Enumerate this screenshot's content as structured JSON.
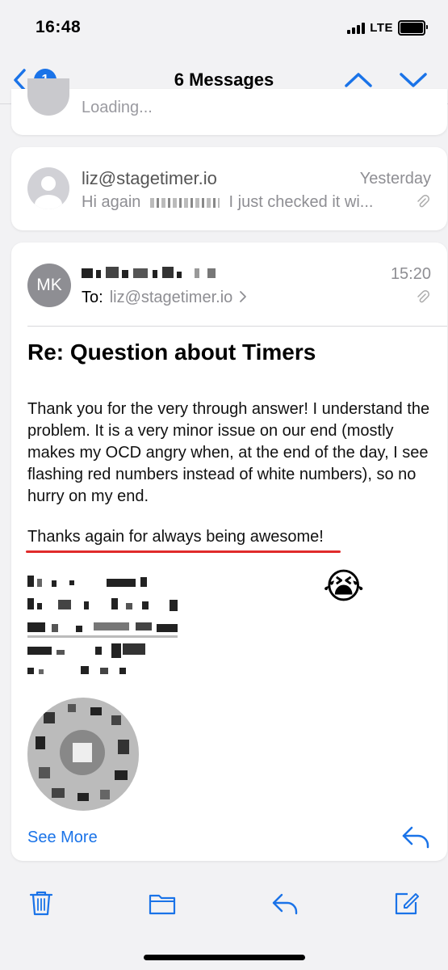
{
  "status_bar": {
    "time": "16:48",
    "network": "LTE"
  },
  "nav": {
    "back_badge": "1",
    "title": "6 Messages",
    "icons": [
      "back-chevron-icon",
      "up-chevron-icon",
      "down-chevron-icon"
    ]
  },
  "messages": [
    {
      "state": "Loading..."
    },
    {
      "sender": "liz@stagetimer.io",
      "date": "Yesterday",
      "preview_start": "Hi again",
      "preview_end": "I just checked it wi...",
      "has_attachment": true
    },
    {
      "initials": "MK",
      "time": "15:20",
      "to_label": "To:",
      "to_address": "liz@stagetimer.io",
      "subject": "Re: Question about Timers",
      "body": "Thank you for the very through answer! I understand the problem. It is a very minor issue on our end (mostly makes my OCD angry when, at the end of the day, I see flashing red numbers instead of white numbers), so no hurry on my end.",
      "closing": "Thanks again for always being awesome!",
      "emoji": "😭",
      "see_more": "See More",
      "has_attachment": true
    }
  ],
  "toolbar": {
    "icons": [
      "trash-icon",
      "folder-icon",
      "reply-icon",
      "compose-icon"
    ]
  },
  "colors": {
    "accent": "#1a73e8",
    "highlight_underline": "#e02b2b",
    "avatar": "#8e8e93"
  }
}
